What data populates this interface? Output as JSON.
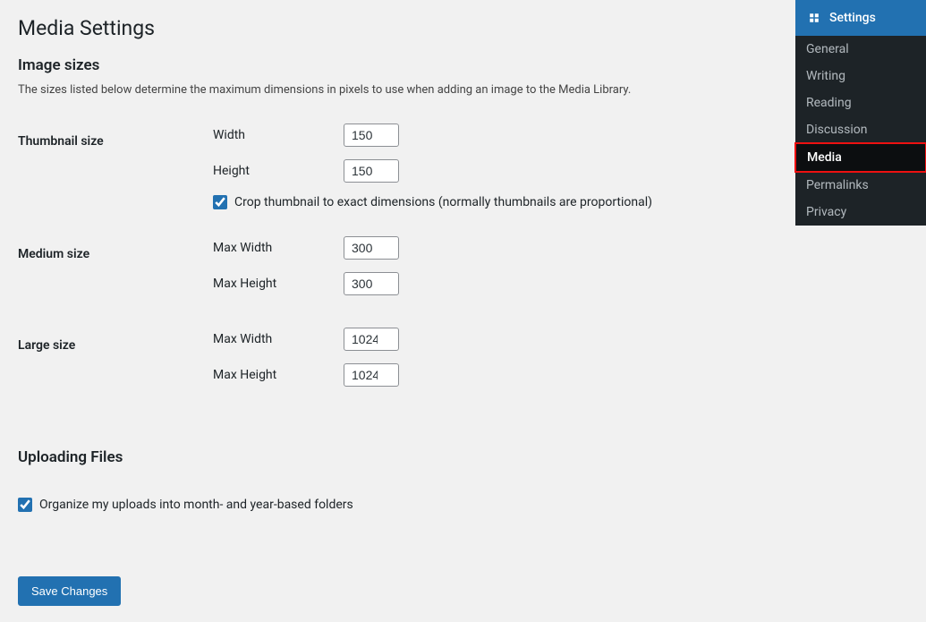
{
  "page": {
    "title": "Media Settings",
    "section1_title": "Image sizes",
    "section1_desc": "The sizes listed below determine the maximum dimensions in pixels to use when adding an image to the Media Library.",
    "section2_title": "Uploading Files"
  },
  "thumbnail": {
    "label": "Thumbnail size",
    "width_label": "Width",
    "width_value": "150",
    "height_label": "Height",
    "height_value": "150",
    "crop_label": "Crop thumbnail to exact dimensions (normally thumbnails are proportional)",
    "crop_checked": true
  },
  "medium": {
    "label": "Medium size",
    "max_width_label": "Max Width",
    "max_width_value": "300",
    "max_height_label": "Max Height",
    "max_height_value": "300"
  },
  "large": {
    "label": "Large size",
    "max_width_label": "Max Width",
    "max_width_value": "1024",
    "max_height_label": "Max Height",
    "max_height_value": "1024"
  },
  "uploads": {
    "organize_label": "Organize my uploads into month- and year-based folders",
    "organize_checked": true
  },
  "save_button": "Save Changes",
  "sidebar": {
    "header": "Settings",
    "items": [
      {
        "label": "General",
        "active": false
      },
      {
        "label": "Writing",
        "active": false
      },
      {
        "label": "Reading",
        "active": false
      },
      {
        "label": "Discussion",
        "active": false
      },
      {
        "label": "Media",
        "active": true
      },
      {
        "label": "Permalinks",
        "active": false
      },
      {
        "label": "Privacy",
        "active": false
      }
    ]
  }
}
